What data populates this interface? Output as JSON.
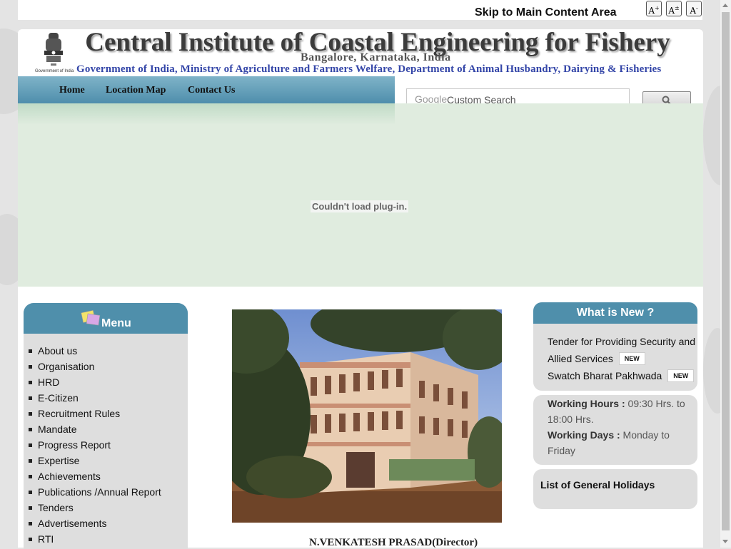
{
  "topbar": {
    "skip_link": "Skip to Main Content Area",
    "font_buttons": [
      {
        "label": "A",
        "mark": "+"
      },
      {
        "label": "A",
        "mark": "±"
      },
      {
        "label": "A",
        "mark": "-"
      }
    ]
  },
  "header": {
    "emblem_caption": "Government of India",
    "title": "Central Institute of Coastal Engineering for Fishery",
    "location": "Bangalore, Karnataka, India",
    "ministry": "Government of India, Ministry of Agriculture and Farmers Welfare, Department of Animal Husbandry, Dairying & Fisheries"
  },
  "nav": {
    "items": [
      {
        "label": "Home"
      },
      {
        "label": "Location Map"
      },
      {
        "label": "Contact Us"
      }
    ]
  },
  "search": {
    "brand": "Google",
    "placeholder": "Custom Search",
    "button_icon": "search-icon"
  },
  "plugin": {
    "message": "Couldn't load plug-in."
  },
  "menu": {
    "title": "Menu",
    "items": [
      {
        "label": "About us"
      },
      {
        "label": "Organisation"
      },
      {
        "label": "HRD"
      },
      {
        "label": "E-Citizen"
      },
      {
        "label": "Recruitment Rules"
      },
      {
        "label": "Mandate"
      },
      {
        "label": "Progress Report"
      },
      {
        "label": "Expertise"
      },
      {
        "label": "Achievements"
      },
      {
        "label": "Publications /Annual Report"
      },
      {
        "label": "Tenders"
      },
      {
        "label": "Advertisements"
      },
      {
        "label": "RTI"
      }
    ]
  },
  "main": {
    "director_caption": "N.VENKATESH PRASAD(Director)"
  },
  "whats_new": {
    "title": "What is New ?",
    "items": [
      {
        "label": "Tender for Providing Security and Allied Services",
        "badge": "NEW"
      },
      {
        "label": "Swatch Bharat Pakhwada",
        "badge": "NEW"
      }
    ]
  },
  "hours": {
    "working_hours_label": "Working Hours :",
    "working_hours_value": "09:30 Hrs. to 18:00 Hrs.",
    "working_days_label": "Working Days :",
    "working_days_value": "Monday to Friday"
  },
  "holidays": {
    "label": "List of General Holidays"
  },
  "colors": {
    "accent": "#4f8fab",
    "ministry_text": "#3446a8",
    "plugin_bg": "#e0ecdf",
    "panel_bg": "#dedede"
  }
}
